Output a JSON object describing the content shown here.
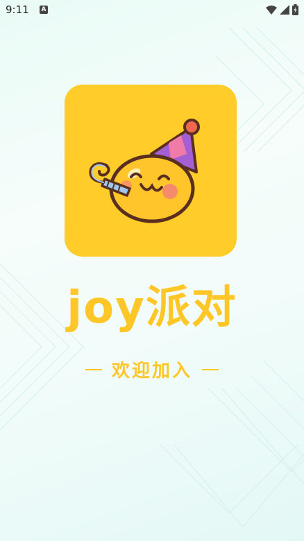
{
  "status_bar": {
    "time": "9:11",
    "icons": [
      "android-notification-icon",
      "wifi-icon",
      "signal-icon",
      "battery-icon"
    ]
  },
  "splash": {
    "app_name": "joy派对",
    "welcome_text": "欢迎加入",
    "logo_icon": "party-smiley-with-hat-icon",
    "accent_color": "#ffc627",
    "icon_bg_color": "#ffcc29"
  }
}
